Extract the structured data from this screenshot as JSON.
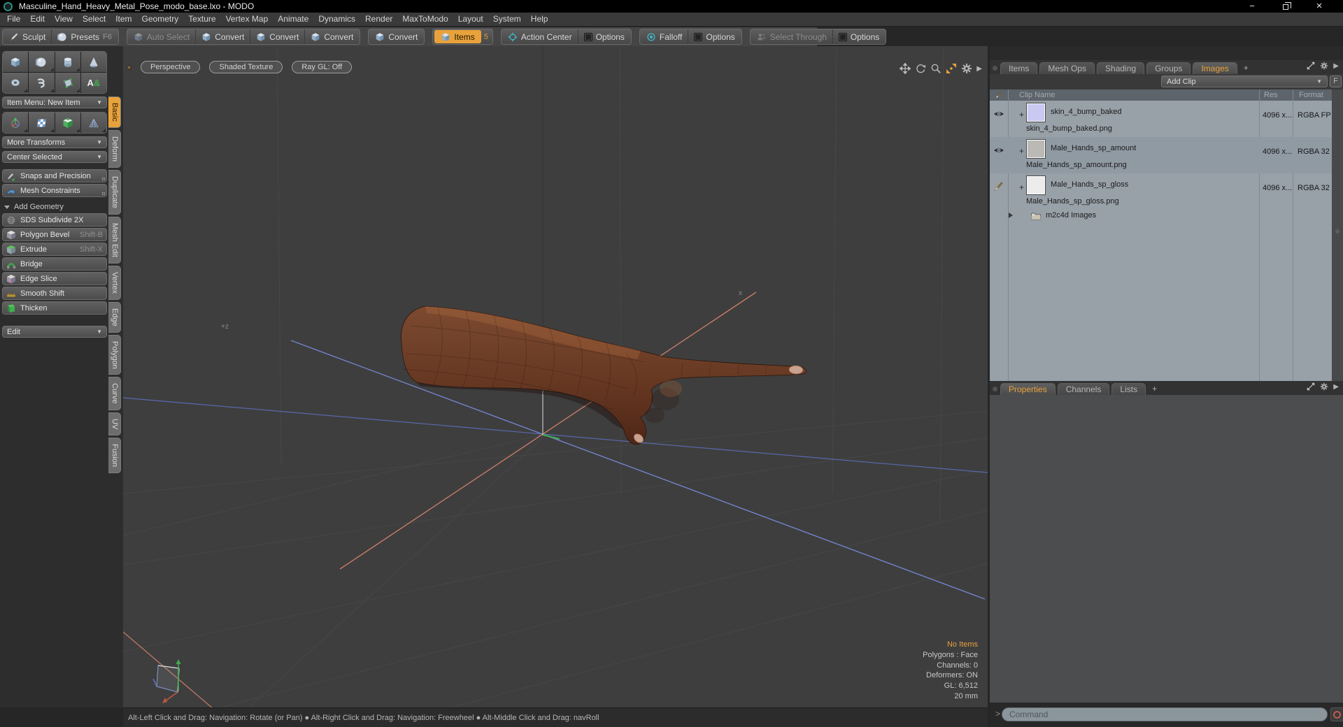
{
  "window": {
    "title": "Masculine_Hand_Heavy_Metal_Pose_modo_base.lxo - MODO",
    "minimize_glyph": "−",
    "close_glyph": "×"
  },
  "menu": {
    "items": [
      "File",
      "Edit",
      "View",
      "Select",
      "Item",
      "Geometry",
      "Texture",
      "Vertex Map",
      "Animate",
      "Dynamics",
      "Render",
      "MaxToModo",
      "Layout",
      "System",
      "Help"
    ]
  },
  "toolbar": {
    "sculpt": "Sculpt",
    "presets": "Presets",
    "presets_shortcut": "F6",
    "auto_select": "Auto Select",
    "convert_a": "Convert",
    "convert_b": "Convert",
    "convert_c": "Convert",
    "convert_d": "Convert",
    "items": "Items",
    "items_shortcut": "5",
    "action_center": "Action Center",
    "options_a": "Options",
    "falloff": "Falloff",
    "options_b": "Options",
    "select_through": "Select Through",
    "options_c": "Options"
  },
  "sidebar": {
    "item_menu": "Item Menu: New Item",
    "more_transforms": "More Transforms",
    "center_selected": "Center Selected",
    "snaps_and_precision": "Snaps and Precision",
    "mesh_constraints": "Mesh Constraints",
    "add_geometry": "Add Geometry",
    "tools": [
      {
        "label": "SDS Subdivide 2X",
        "shortcut": ""
      },
      {
        "label": "Polygon Bevel",
        "shortcut": "Shift-B"
      },
      {
        "label": "Extrude",
        "shortcut": "Shift-X"
      },
      {
        "label": "Bridge",
        "shortcut": ""
      },
      {
        "label": "Edge Slice",
        "shortcut": ""
      },
      {
        "label": "Smooth Shift",
        "shortcut": ""
      },
      {
        "label": "Thicken",
        "shortcut": ""
      }
    ],
    "edit": "Edit",
    "tabs": [
      "Basic",
      "Deform",
      "Duplicate",
      "Mesh Edit",
      "Vertex",
      "Edge",
      "Polygon",
      "Curve",
      "UV",
      "Fusion"
    ],
    "selected_tab": "Basic"
  },
  "viewport": {
    "mode": "Perspective",
    "shading": "Shaded Texture",
    "raygl": "Ray GL: Off",
    "axis_label_left": "+z",
    "axis_label_right": "x",
    "status": [
      "No Items",
      "Polygons : Face",
      "Channels: 0",
      "Deformers: ON",
      "GL: 6,512",
      "20 mm"
    ]
  },
  "images_panel": {
    "tabs": [
      "Items",
      "Mesh Ops",
      "Shading",
      "Groups",
      "Images"
    ],
    "selected_tab": "Images",
    "new_tab": "+",
    "add_clip": "Add Clip",
    "fit_button": "F",
    "columns": {
      "clip_name": "Clip Name",
      "res": "Res",
      "format": "Format"
    },
    "clips": [
      {
        "name": "skin_4_bump_baked",
        "file": "skin_4_bump_baked.png",
        "res": "4096 x...",
        "format": "RGBA FP",
        "thumb_color": "#c9c9f2",
        "expander": "+"
      },
      {
        "name": "Male_Hands_sp_amount",
        "file": "Male_Hands_sp_amount.png",
        "res": "4096 x...",
        "format": "RGBA 32",
        "thumb_color": "#bab9b5",
        "expander": "+"
      },
      {
        "name": "Male_Hands_sp_gloss",
        "file": "Male_Hands_sp_gloss.png",
        "res": "4096 x...",
        "format": "RGBA 32",
        "thumb_color": "#ececec",
        "expander": "+"
      }
    ],
    "folder": "m2c4d Images"
  },
  "properties_panel": {
    "tabs": [
      "Properties",
      "Channels",
      "Lists"
    ],
    "selected_tab": "Properties",
    "new_tab": "+"
  },
  "command": {
    "prompt": ">",
    "placeholder": "Command"
  },
  "statusbar": {
    "hint": "Alt-Left Click and Drag: Navigation: Rotate (or Pan) ● Alt-Right Click and Drag: Navigation: Freewheel ● Alt-Middle Click and Drag: navRoll"
  },
  "colors": {
    "accent_orange": "#e8a23c",
    "list_bg": "#98a0a8",
    "viewport_bg": "#3e3e3e",
    "axis_red": "#c97b66",
    "axis_blue": "#7284cc",
    "axis_green": "#3fae4f",
    "teal_icon": "#3fb8c9"
  }
}
